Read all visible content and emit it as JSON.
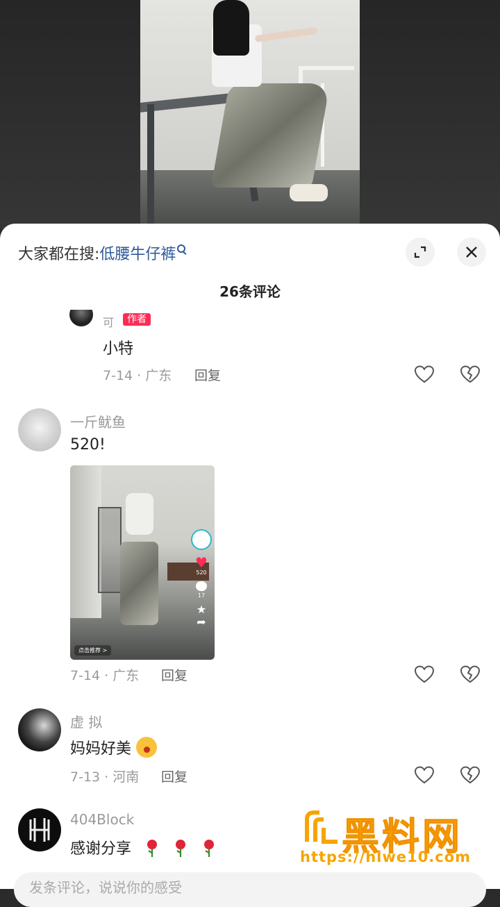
{
  "search_bar": {
    "prefix": "大家都在搜:",
    "keyword": "低腰牛仔裤"
  },
  "header": {
    "comment_count": "26条评论"
  },
  "reply": {
    "name": "可",
    "author_tag": "作者",
    "text": "小特",
    "meta": "7-14 · 广东",
    "reply_label": "回复"
  },
  "comments": [
    {
      "name": "一斤鱿鱼",
      "text": "520!",
      "meta": "7-14 · 广东",
      "reply_label": "回复",
      "thumbnail": {
        "like_count": "520",
        "comment_count": "17",
        "bottom_label": "点击推荐 >"
      }
    },
    {
      "name": "虚 拟",
      "text": "妈妈好美",
      "meta": "7-13 · 河南",
      "reply_label": "回复"
    },
    {
      "name": "404Block",
      "text": "感谢分享"
    }
  ],
  "watermark": {
    "title": "黑料网",
    "url": "https://hlwe10.com"
  },
  "input": {
    "placeholder": "发条评论，说说你的感受"
  },
  "colors": {
    "accent": "#fe2c55",
    "link": "#2d5a9a",
    "watermark": "#f7a400"
  }
}
